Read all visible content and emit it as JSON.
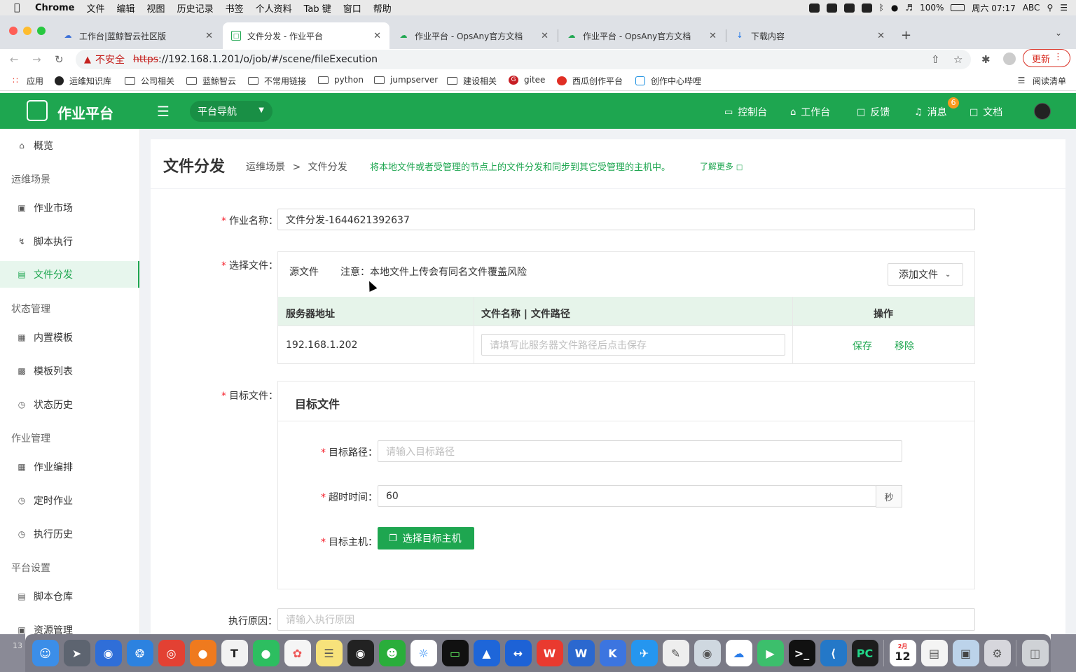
{
  "menubar": {
    "app": "Chrome",
    "items": [
      "文件",
      "编辑",
      "视图",
      "历史记录",
      "书签",
      "个人资料",
      "Tab 键",
      "窗口",
      "帮助"
    ],
    "battery": "100%",
    "clock": "周六 07:17",
    "input_method": "ABC"
  },
  "tabs": [
    {
      "title": "工作台|蓝鲸智云社区版",
      "icon": "cloud-icon"
    },
    {
      "title": "文件分发 - 作业平台",
      "icon": "doc-icon"
    },
    {
      "title": "作业平台 - OpsAny官方文档",
      "icon": "cloud-icon"
    },
    {
      "title": "作业平台 - OpsAny官方文档",
      "icon": "cloud-icon"
    },
    {
      "title": "下载内容",
      "icon": "download-icon"
    }
  ],
  "address": {
    "insecure": "不安全",
    "protocol": "https",
    "url": "://192.168.1.201/o/job/#/scene/fileExecution",
    "update": "更新"
  },
  "bookmarks": [
    {
      "label": "应用",
      "type": "apps"
    },
    {
      "label": "运维知识库",
      "type": "site"
    },
    {
      "label": "公司相关",
      "type": "folder"
    },
    {
      "label": "蓝鲸智云",
      "type": "folder"
    },
    {
      "label": "不常用链接",
      "type": "folder"
    },
    {
      "label": "python",
      "type": "folder"
    },
    {
      "label": "jumpserver",
      "type": "folder"
    },
    {
      "label": "建设相关",
      "type": "folder"
    },
    {
      "label": "gitee",
      "type": "site"
    },
    {
      "label": "西瓜创作平台",
      "type": "site"
    },
    {
      "label": "创作中心哔哩",
      "type": "site"
    },
    {
      "label": "阅读清单",
      "type": "reading-list"
    }
  ],
  "header": {
    "app_name": "作业平台",
    "platform_nav": "平台导航",
    "nav": [
      "控制台",
      "工作台",
      "反馈",
      "消息",
      "文档"
    ],
    "message_badge": "6"
  },
  "sidebar": {
    "items": [
      {
        "label": "概览",
        "icon": "home-icon"
      },
      {
        "group": "运维场景"
      },
      {
        "label": "作业市场",
        "icon": "cart-icon"
      },
      {
        "label": "脚本执行",
        "icon": "bolt-icon"
      },
      {
        "label": "文件分发",
        "icon": "file-icon",
        "active": true
      },
      {
        "group": "状态管理"
      },
      {
        "label": "内置模板",
        "icon": "template-icon"
      },
      {
        "label": "模板列表",
        "icon": "list-icon"
      },
      {
        "label": "状态历史",
        "icon": "history-icon"
      },
      {
        "group": "作业管理"
      },
      {
        "label": "作业编排",
        "icon": "orchestrate-icon"
      },
      {
        "label": "定时作业",
        "icon": "clock-icon"
      },
      {
        "label": "执行历史",
        "icon": "history-icon"
      },
      {
        "group": "平台设置"
      },
      {
        "label": "脚本仓库",
        "icon": "repo-icon"
      },
      {
        "label": "资源管理",
        "icon": "resource-icon"
      }
    ]
  },
  "page": {
    "title": "文件分发",
    "breadcrumb": [
      "运维场景",
      ">",
      "文件分发"
    ],
    "description": "将本地文件或者受管理的节点上的文件分发和同步到其它受管理的主机中。",
    "learn_more": "了解更多"
  },
  "form": {
    "job_name_label": "作业名称",
    "job_name_value": "文件分发-1644621392637",
    "select_file_label": "选择文件",
    "source_file": "源文件",
    "notice": "注意：本地文件上传会有同名文件覆盖风险",
    "add_file": "添加文件",
    "table": {
      "columns": [
        "服务器地址",
        "文件名称 | 文件路径",
        "操作"
      ],
      "rows": [
        {
          "server": "192.168.1.202",
          "path_placeholder": "请填写此服务器文件路径后点击保存",
          "actions": [
            "保存",
            "移除"
          ]
        }
      ]
    },
    "target_file_label": "目标文件",
    "target_panel_title": "目标文件",
    "target_path_label": "目标路径",
    "target_path_placeholder": "请输入目标路径",
    "timeout_label": "超时时间",
    "timeout_value": "60",
    "timeout_unit": "秒",
    "target_host_label": "目标主机",
    "select_host_button": "选择目标主机",
    "reason_label": "执行原因",
    "reason_placeholder": "请输入执行原因"
  },
  "dock": {
    "apps": [
      "finder",
      "launchpad",
      "feishu",
      "safari",
      "chrome",
      "firefox",
      "typora",
      "evernote",
      "photos",
      "notes",
      "qq",
      "wechat",
      "dingtalk",
      "terminal-ext",
      "lark",
      "teamviewer",
      "wps",
      "word",
      "kk",
      "mail",
      "notes2",
      "instruments",
      "baidu-netdisk",
      "tencent-video",
      "terminal",
      "vscode",
      "pycharm"
    ],
    "right_apps": [
      "calendar",
      "textedit",
      "preview",
      "launch"
    ],
    "calendar_day": "12",
    "calendar_month": "2月",
    "left_number": "13"
  },
  "colors": {
    "primary": "#1ea650",
    "header": "#1ea650",
    "badge": "#f79a1e",
    "required": "#f5222d"
  }
}
